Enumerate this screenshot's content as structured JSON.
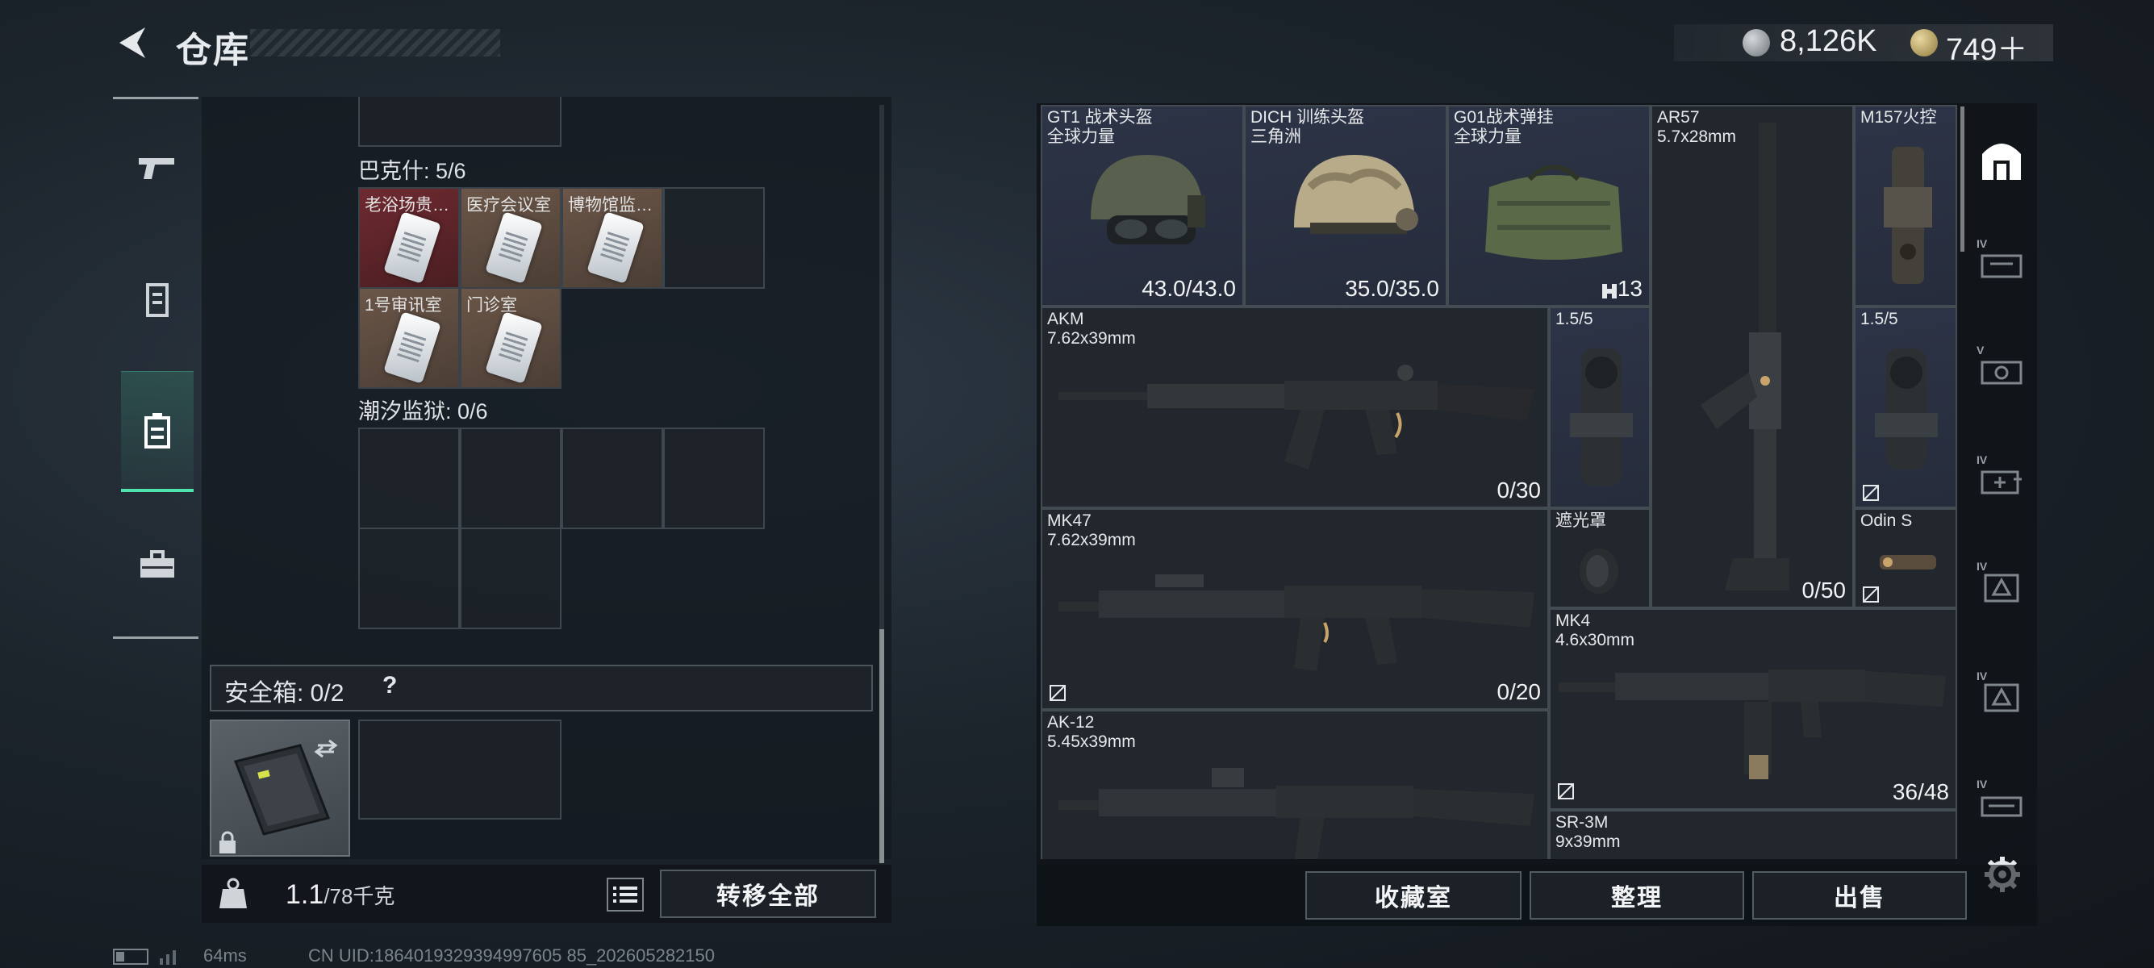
{
  "header": {
    "title": "仓库",
    "currency1": "8,126K",
    "currency2": "749＋"
  },
  "left": {
    "section1_label": "巴克什: 5/6",
    "section1_cards": [
      {
        "label": "老浴场贵…",
        "color": "red"
      },
      {
        "label": "医疗会议室",
        "color": "tan"
      },
      {
        "label": "博物馆监…",
        "color": "tan"
      },
      {
        "label": "1号审讯室",
        "color": "tan"
      },
      {
        "label": "门诊室",
        "color": "tan"
      }
    ],
    "section2_label": "潮汐监狱: 0/6",
    "safe_label": "安全箱:  0/2",
    "help": "?",
    "weight_value": "1.1",
    "weight_unit": "/78千克",
    "transfer_all": "转移全部"
  },
  "stash": {
    "items": [
      {
        "name": "GT1 战术头盔",
        "sub": "全球力量",
        "value": "43.0/43.0"
      },
      {
        "name": "DICH 训练头盔",
        "sub": "三角洲",
        "value": "35.0/35.0"
      },
      {
        "name": "G01战术弹挂",
        "sub": "全球力量",
        "value": "13"
      },
      {
        "name": "AR57",
        "sub": "5.7x28mm",
        "value": "0/50"
      },
      {
        "name": "M157火控",
        "sub": "",
        "value": ""
      },
      {
        "name": "AKM",
        "sub": "7.62x39mm",
        "value": "0/30"
      },
      {
        "name": "1.5/5",
        "sub": "",
        "value": ""
      },
      {
        "name": "1.5/5",
        "sub": "",
        "value": ""
      },
      {
        "name": "MK47",
        "sub": "7.62x39mm",
        "value": "0/20"
      },
      {
        "name": "遮光罩",
        "sub": "",
        "value": ""
      },
      {
        "name": "Odin S",
        "sub": "",
        "value": ""
      },
      {
        "name": "MK4",
        "sub": "4.6x30mm",
        "value": "36/48"
      },
      {
        "name": "AK-12",
        "sub": "5.45x39mm",
        "value": ""
      },
      {
        "name": "SR-3M",
        "sub": "9x39mm",
        "value": ""
      }
    ],
    "buttons": {
      "collection": "收藏室",
      "sort": "整理",
      "sell": "出售"
    },
    "tabs": [
      {
        "label": ""
      },
      {
        "label": "IV"
      },
      {
        "label": "V"
      },
      {
        "label": "IV"
      },
      {
        "label": "IV"
      },
      {
        "label": "IV"
      },
      {
        "label": "IV"
      }
    ]
  },
  "status": {
    "ping": "64ms",
    "uid": "CN UID:1864019329394997605 85_202605282150"
  },
  "colors": {
    "accent": "#4fe3b0"
  }
}
